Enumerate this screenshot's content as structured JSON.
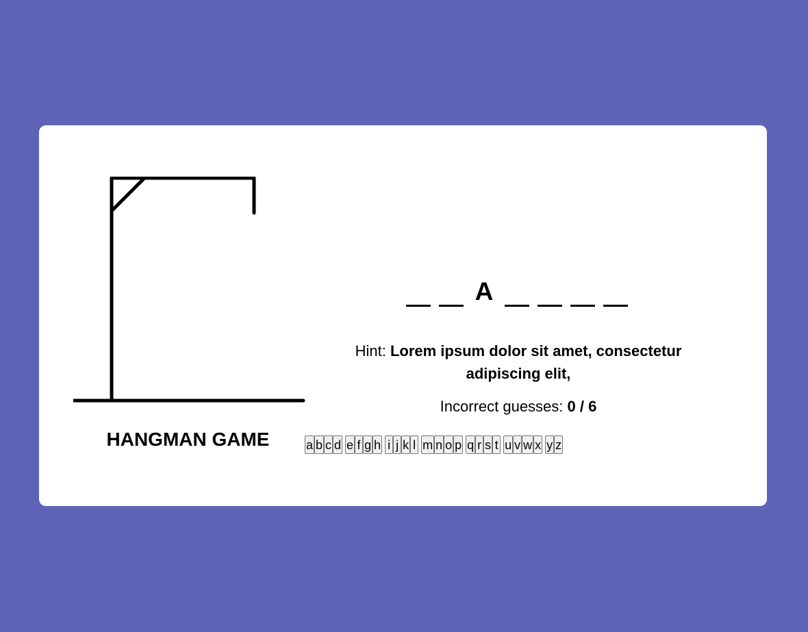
{
  "game": {
    "title": "HANGMAN GAME",
    "word_slots": [
      "",
      "",
      "A",
      "",
      "",
      "",
      ""
    ],
    "hint_label": "Hint: ",
    "hint_text": "Lorem ipsum dolor sit amet, consectetur adipiscing elit,",
    "guesses_label": "Incorrect guesses: ",
    "guesses_value": "0 / 6"
  },
  "keyboard": {
    "keys": [
      "a",
      "b",
      "c",
      "d",
      "e",
      "f",
      "g",
      "h",
      "i",
      "j",
      "k",
      "l",
      "m",
      "n",
      "o",
      "p",
      "q",
      "r",
      "s",
      "t",
      "u",
      "v",
      "w",
      "x",
      "y",
      "z"
    ]
  },
  "colors": {
    "background": "#5e63b8",
    "card": "#ffffff",
    "ink": "#000000"
  }
}
